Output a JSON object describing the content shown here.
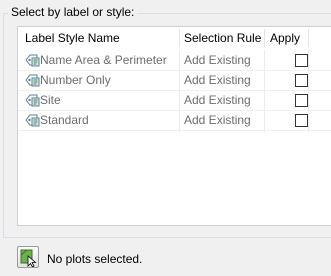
{
  "group": {
    "title": "Select by label or style:"
  },
  "table": {
    "columns": [
      "Label Style Name",
      "Selection Rule",
      "Apply"
    ],
    "rows": [
      {
        "name": "Name Area & Perimeter",
        "rule": "Add Existing",
        "apply": false,
        "icon": "label-style-icon"
      },
      {
        "name": "Number Only",
        "rule": "Add Existing",
        "apply": false,
        "icon": "label-style-icon"
      },
      {
        "name": "Site",
        "rule": "Add Existing",
        "apply": false,
        "icon": "label-style-icon"
      },
      {
        "name": "Standard",
        "rule": "Add Existing",
        "apply": false,
        "icon": "label-style-icon"
      }
    ]
  },
  "status": {
    "text": "No plots selected.",
    "icon": "pick-plots-icon"
  }
}
